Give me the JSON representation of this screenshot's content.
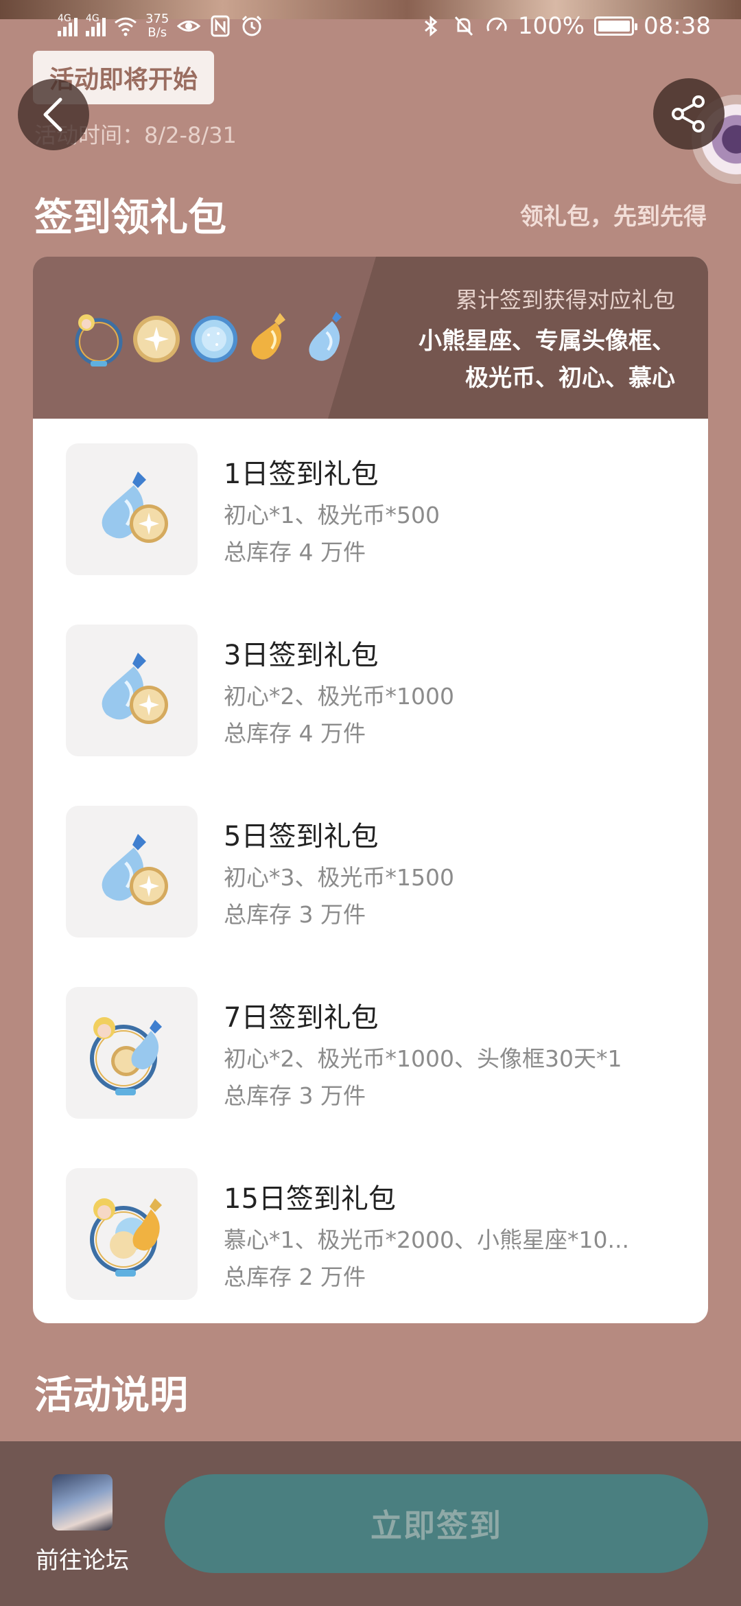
{
  "status_bar": {
    "net_speed_value": "375",
    "net_speed_unit": "B/s",
    "network_labels": [
      "4G",
      "4G"
    ],
    "battery_percent": "100%",
    "time": "08:38"
  },
  "header": {
    "status_pill": "活动即将开始",
    "activity_time": "活动时间：8/2-8/31"
  },
  "checkin_section": {
    "title": "签到领礼包",
    "subtitle": "领礼包，先到先得"
  },
  "card_head": {
    "line1": "累计签到获得对应礼包",
    "line2": "小熊星座、专属头像框、",
    "line3": "极光币、初心、慕心",
    "reward_icons": [
      "avatar-frame-icon",
      "aurora-coin-icon",
      "bear-constellation-icon",
      "muxin-potion-icon",
      "chuxin-potion-icon"
    ]
  },
  "gifts": [
    {
      "name": "1日签到礼包",
      "desc": "初心*1、极光币*500",
      "stock": "总库存 4 万件",
      "icon": "potion-coin-icon"
    },
    {
      "name": "3日签到礼包",
      "desc": "初心*2、极光币*1000",
      "stock": "总库存 4 万件",
      "icon": "potion-coin-icon"
    },
    {
      "name": "5日签到礼包",
      "desc": "初心*3、极光币*1500",
      "stock": "总库存 3 万件",
      "icon": "potion-coin-icon"
    },
    {
      "name": "7日签到礼包",
      "desc": "初心*2、极光币*1000、头像框30天*1",
      "stock": "总库存 3 万件",
      "icon": "frame-coin-potion-icon"
    },
    {
      "name": "15日签到礼包",
      "desc": "慕心*1、极光币*2000、小熊星座*10...",
      "stock": "总库存 2 万件",
      "icon": "frame-bear-potion-icon"
    }
  ],
  "description_section": {
    "title": "活动说明"
  },
  "bottom_bar": {
    "forum_label": "前往论坛",
    "checkin_label": "立即签到"
  },
  "colors": {
    "page_bg": "#b68a80",
    "card_head_bg": "#75564f",
    "bottom_bar_bg": "#715752",
    "checkin_button_bg": "#4a7f80",
    "checkin_button_text": "#8fa9a7"
  }
}
